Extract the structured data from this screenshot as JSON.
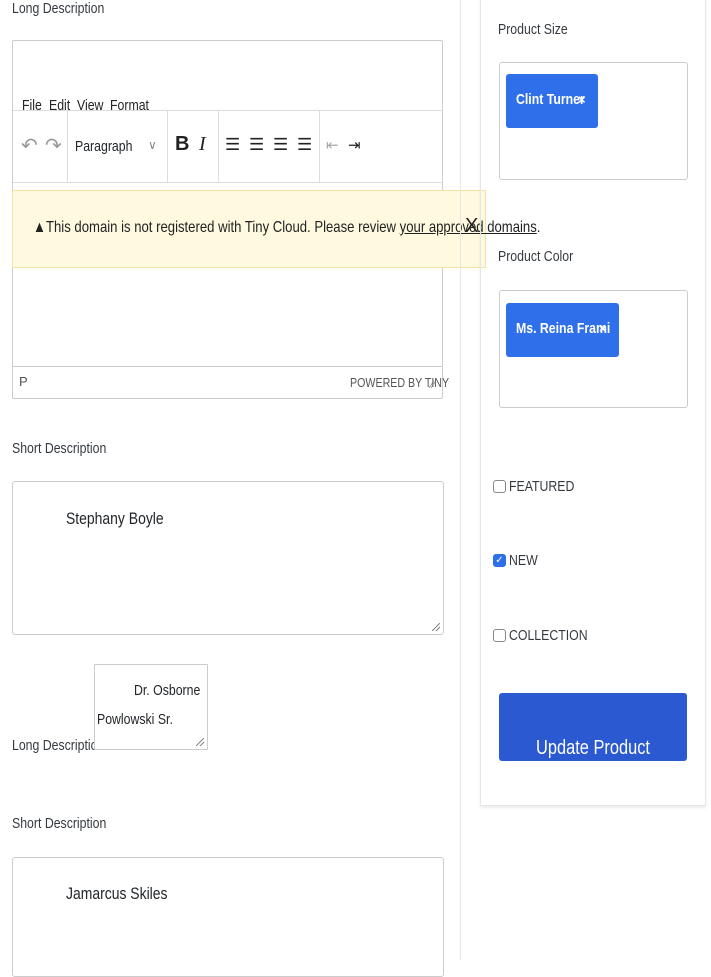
{
  "left": {
    "long_description_label_top": "Long Description",
    "editor": {
      "menu": [
        "File",
        "Edit",
        "View",
        "Format"
      ],
      "block_format": "Paragraph",
      "status_path": "P",
      "branding": "POWERED BY TINY"
    },
    "notice": {
      "text": "This domain is not registered with Tiny Cloud. Please review ",
      "link": "your approved domains",
      "after": ".",
      "close": "X"
    },
    "short_description_label_1": "Short Description",
    "short_description_value_1": "Stephany Boyle",
    "long_description_label_2": "Long Description",
    "long_description_value_2_line1": "Dr. Osborne",
    "long_description_value_2_line2": "Powlowski Sr.",
    "short_description_label_2": "Short Description",
    "short_description_value_2": "Jamarcus Skiles"
  },
  "right": {
    "product_size_label": "Product Size",
    "product_size_chip": "Clint Turner",
    "product_color_label": "Product Color",
    "product_color_chip": "Ms. Reina Frami",
    "chip_remove": "×",
    "checkboxes": [
      {
        "label": "FEATURED",
        "checked": false
      },
      {
        "label": "NEW",
        "checked": true
      },
      {
        "label": "COLLECTION",
        "checked": false
      }
    ],
    "update_button": "Update Product"
  },
  "colors": {
    "accent": "#2f6fea",
    "button": "#2a59d1",
    "notice_bg": "#fff9e0"
  }
}
